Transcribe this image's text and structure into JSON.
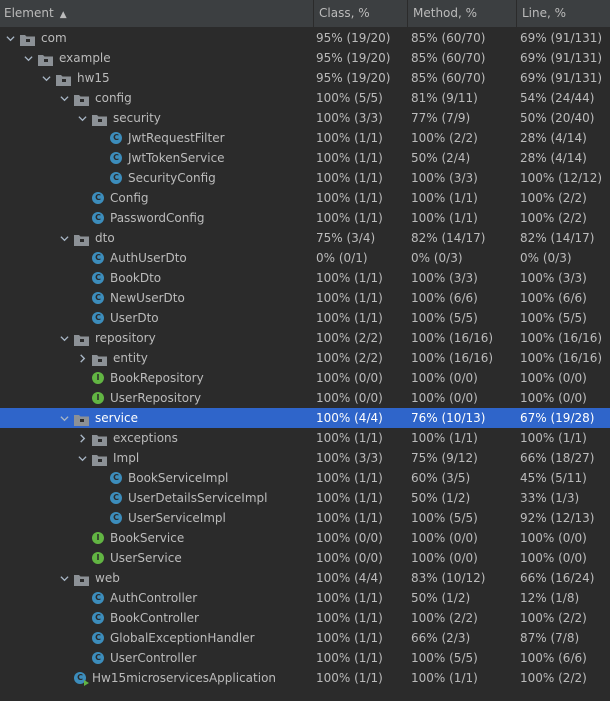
{
  "header": {
    "element": "Element",
    "class": "Class, %",
    "method": "Method, %",
    "line": "Line, %"
  },
  "rows": [
    {
      "label": "com",
      "type": "package",
      "depth": 0,
      "expanded": true,
      "class": "95% (19/20)",
      "method": "85% (60/70)",
      "line": "69% (91/131)"
    },
    {
      "label": "example",
      "type": "package",
      "depth": 1,
      "expanded": true,
      "class": "95% (19/20)",
      "method": "85% (60/70)",
      "line": "69% (91/131)"
    },
    {
      "label": "hw15",
      "type": "package",
      "depth": 2,
      "expanded": true,
      "class": "95% (19/20)",
      "method": "85% (60/70)",
      "line": "69% (91/131)"
    },
    {
      "label": "config",
      "type": "package",
      "depth": 3,
      "expanded": true,
      "class": "100% (5/5)",
      "method": "81% (9/11)",
      "line": "54% (24/44)"
    },
    {
      "label": "security",
      "type": "package",
      "depth": 4,
      "expanded": true,
      "class": "100% (3/3)",
      "method": "77% (7/9)",
      "line": "50% (20/40)"
    },
    {
      "label": "JwtRequestFilter",
      "type": "class",
      "depth": 5,
      "class": "100% (1/1)",
      "method": "100% (2/2)",
      "line": "28% (4/14)"
    },
    {
      "label": "JwtTokenService",
      "type": "class",
      "depth": 5,
      "class": "100% (1/1)",
      "method": "50% (2/4)",
      "line": "28% (4/14)"
    },
    {
      "label": "SecurityConfig",
      "type": "class",
      "depth": 5,
      "class": "100% (1/1)",
      "method": "100% (3/3)",
      "line": "100% (12/12)"
    },
    {
      "label": "Config",
      "type": "class",
      "depth": 4,
      "class": "100% (1/1)",
      "method": "100% (1/1)",
      "line": "100% (2/2)"
    },
    {
      "label": "PasswordConfig",
      "type": "class",
      "depth": 4,
      "class": "100% (1/1)",
      "method": "100% (1/1)",
      "line": "100% (2/2)"
    },
    {
      "label": "dto",
      "type": "package",
      "depth": 3,
      "expanded": true,
      "class": "75% (3/4)",
      "method": "82% (14/17)",
      "line": "82% (14/17)"
    },
    {
      "label": "AuthUserDto",
      "type": "class",
      "depth": 4,
      "class": "0% (0/1)",
      "method": "0% (0/3)",
      "line": "0% (0/3)"
    },
    {
      "label": "BookDto",
      "type": "class",
      "depth": 4,
      "class": "100% (1/1)",
      "method": "100% (3/3)",
      "line": "100% (3/3)"
    },
    {
      "label": "NewUserDto",
      "type": "class",
      "depth": 4,
      "class": "100% (1/1)",
      "method": "100% (6/6)",
      "line": "100% (6/6)"
    },
    {
      "label": "UserDto",
      "type": "class",
      "depth": 4,
      "class": "100% (1/1)",
      "method": "100% (5/5)",
      "line": "100% (5/5)"
    },
    {
      "label": "repository",
      "type": "package",
      "depth": 3,
      "expanded": true,
      "class": "100% (2/2)",
      "method": "100% (16/16)",
      "line": "100% (16/16)"
    },
    {
      "label": "entity",
      "type": "package",
      "depth": 4,
      "expanded": false,
      "class": "100% (2/2)",
      "method": "100% (16/16)",
      "line": "100% (16/16)"
    },
    {
      "label": "BookRepository",
      "type": "interface",
      "depth": 4,
      "class": "100% (0/0)",
      "method": "100% (0/0)",
      "line": "100% (0/0)"
    },
    {
      "label": "UserRepository",
      "type": "interface",
      "depth": 4,
      "class": "100% (0/0)",
      "method": "100% (0/0)",
      "line": "100% (0/0)"
    },
    {
      "label": "service",
      "type": "package",
      "depth": 3,
      "expanded": true,
      "selected": true,
      "class": "100% (4/4)",
      "method": "76% (10/13)",
      "line": "67% (19/28)"
    },
    {
      "label": "exceptions",
      "type": "package",
      "depth": 4,
      "expanded": false,
      "class": "100% (1/1)",
      "method": "100% (1/1)",
      "line": "100% (1/1)"
    },
    {
      "label": "Impl",
      "type": "package",
      "depth": 4,
      "expanded": true,
      "class": "100% (3/3)",
      "method": "75% (9/12)",
      "line": "66% (18/27)"
    },
    {
      "label": "BookServiceImpl",
      "type": "class",
      "depth": 5,
      "class": "100% (1/1)",
      "method": "60% (3/5)",
      "line": "45% (5/11)"
    },
    {
      "label": "UserDetailsServiceImpl",
      "type": "class",
      "depth": 5,
      "class": "100% (1/1)",
      "method": "50% (1/2)",
      "line": "33% (1/3)"
    },
    {
      "label": "UserServiceImpl",
      "type": "class",
      "depth": 5,
      "class": "100% (1/1)",
      "method": "100% (5/5)",
      "line": "92% (12/13)"
    },
    {
      "label": "BookService",
      "type": "interface",
      "depth": 4,
      "class": "100% (0/0)",
      "method": "100% (0/0)",
      "line": "100% (0/0)"
    },
    {
      "label": "UserService",
      "type": "interface",
      "depth": 4,
      "class": "100% (0/0)",
      "method": "100% (0/0)",
      "line": "100% (0/0)"
    },
    {
      "label": "web",
      "type": "package",
      "depth": 3,
      "expanded": true,
      "class": "100% (4/4)",
      "method": "83% (10/12)",
      "line": "66% (16/24)"
    },
    {
      "label": "AuthController",
      "type": "class",
      "depth": 4,
      "class": "100% (1/1)",
      "method": "50% (1/2)",
      "line": "12% (1/8)"
    },
    {
      "label": "BookController",
      "type": "class",
      "depth": 4,
      "class": "100% (1/1)",
      "method": "100% (2/2)",
      "line": "100% (2/2)"
    },
    {
      "label": "GlobalExceptionHandler",
      "type": "class",
      "depth": 4,
      "class": "100% (1/1)",
      "method": "66% (2/3)",
      "line": "87% (7/8)"
    },
    {
      "label": "UserController",
      "type": "class",
      "depth": 4,
      "class": "100% (1/1)",
      "method": "100% (5/5)",
      "line": "100% (6/6)"
    },
    {
      "label": "Hw15microservicesApplication",
      "type": "app",
      "depth": 3,
      "class": "100% (1/1)",
      "method": "100% (1/1)",
      "line": "100% (2/2)"
    }
  ],
  "colors": {
    "background": "#2b2b2b",
    "header": "#3c3f41",
    "selection": "#2f65ca",
    "class_icon": "#3c8dbc",
    "interface_icon": "#62b543",
    "folder": "#8c9196"
  }
}
